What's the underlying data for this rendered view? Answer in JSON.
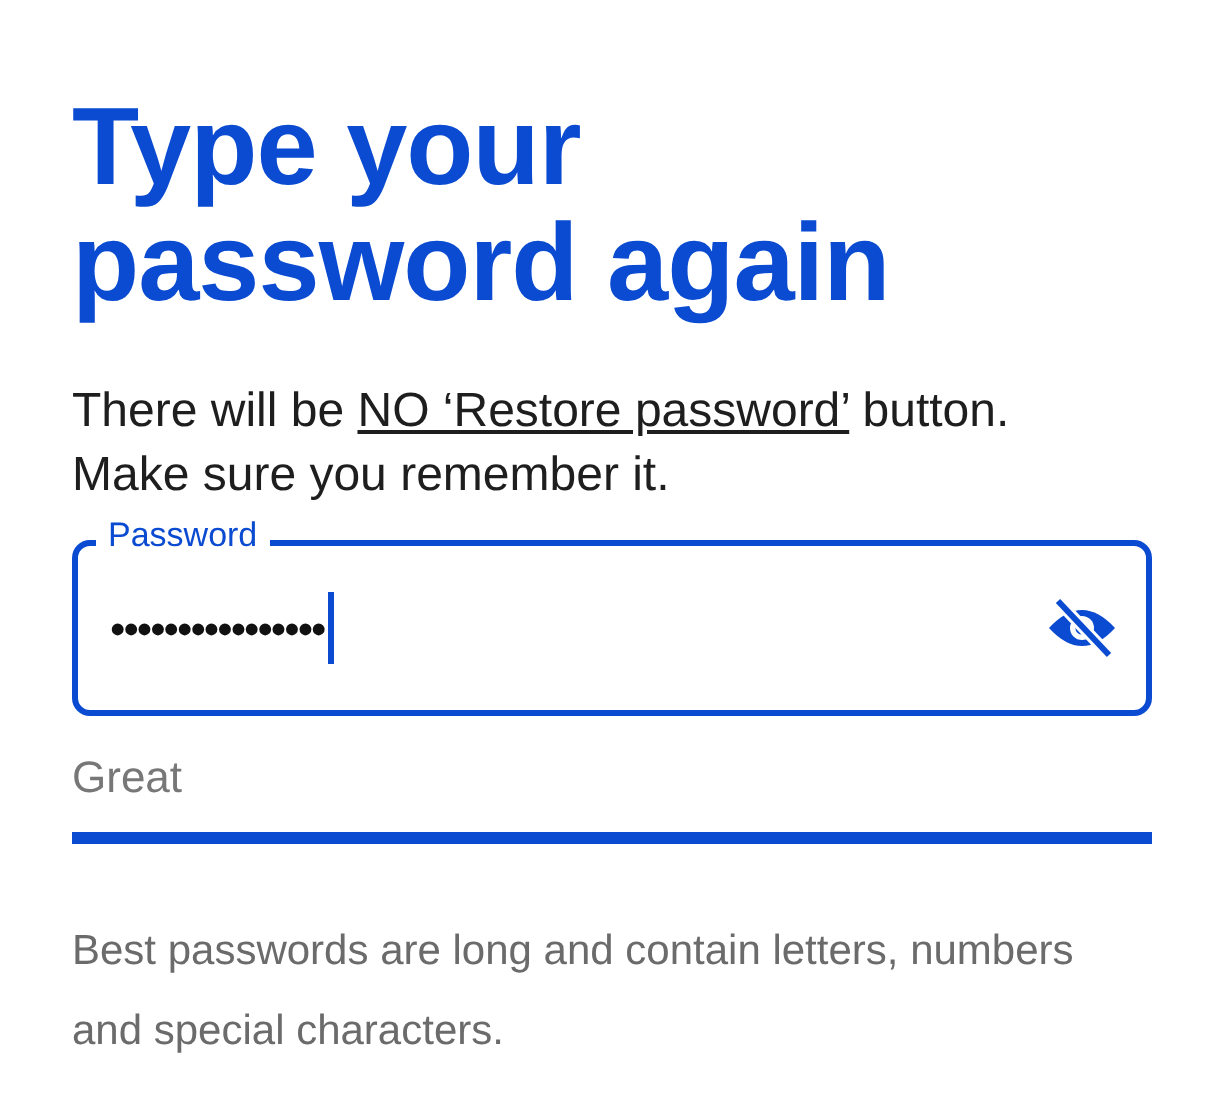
{
  "title": "Type your password again",
  "notice": {
    "before": "There will be ",
    "link": "NO ‘Restore password’",
    "after": " button. Make sure you remember it."
  },
  "password_field": {
    "label": "Password",
    "value": "••••••••••••••••",
    "focused": true,
    "visible": false
  },
  "strength": {
    "label": "Great",
    "level": 1
  },
  "hint": "Best passwords are long and contain letters, numbers and special characters."
}
